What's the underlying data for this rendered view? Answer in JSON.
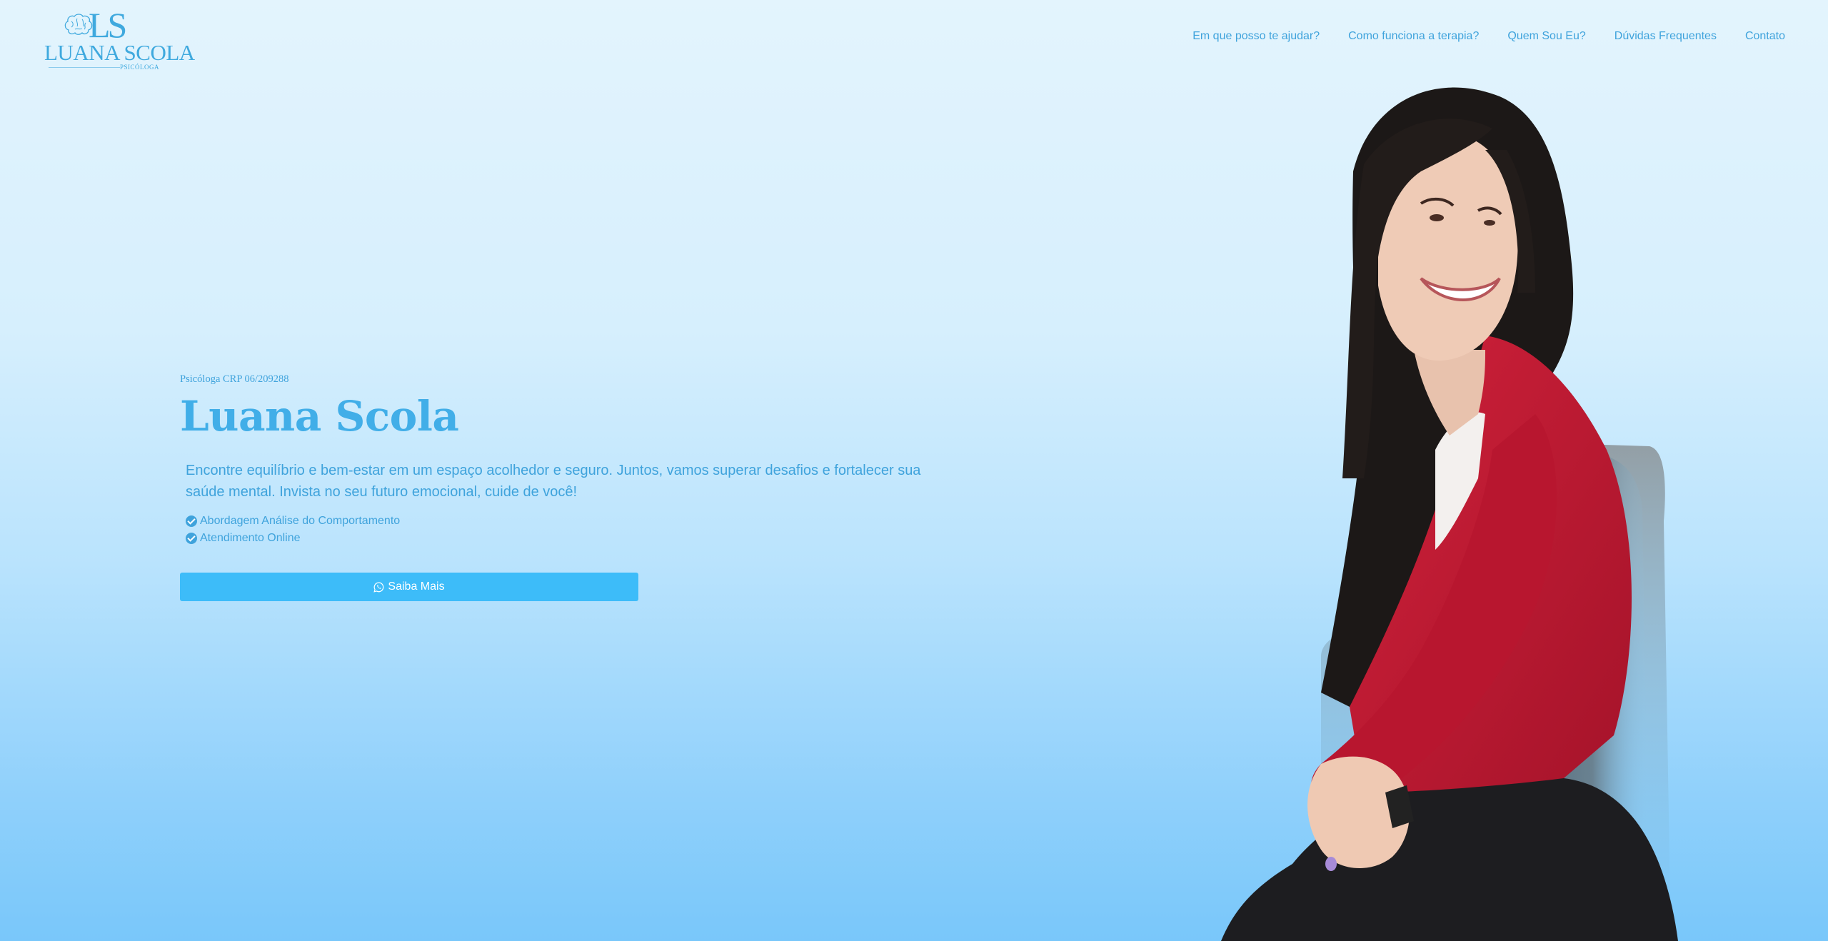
{
  "logo": {
    "monogram": "LS",
    "name": "LUANA SCOLA",
    "subtitle": "PSICÓLOGA"
  },
  "nav": {
    "items": [
      {
        "label": "Em que posso te ajudar?"
      },
      {
        "label": "Como funciona a terapia?"
      },
      {
        "label": "Quem Sou Eu?"
      },
      {
        "label": "Dúvidas Frequentes"
      },
      {
        "label": "Contato"
      }
    ]
  },
  "hero": {
    "crp": "Psicóloga CRP 06/209288",
    "title": "Luana Scola",
    "description": "Encontre equilíbrio e bem-estar em um espaço acolhedor e seguro. Juntos, vamos superar desafios e fortalecer sua saúde mental. Invista no seu futuro emocional, cuide de você!",
    "features": [
      {
        "label": "Abordagem Análise do Comportamento",
        "icon": "check-circle-icon"
      },
      {
        "label": "Atendimento Online",
        "icon": "check-circle-icon"
      }
    ],
    "cta_label": "Saiba Mais",
    "cta_icon": "whatsapp-icon"
  },
  "colors": {
    "accent": "#3fa3dc",
    "button": "#3dbcf9",
    "jacket": "#c1172f",
    "hair": "#1c1817"
  }
}
